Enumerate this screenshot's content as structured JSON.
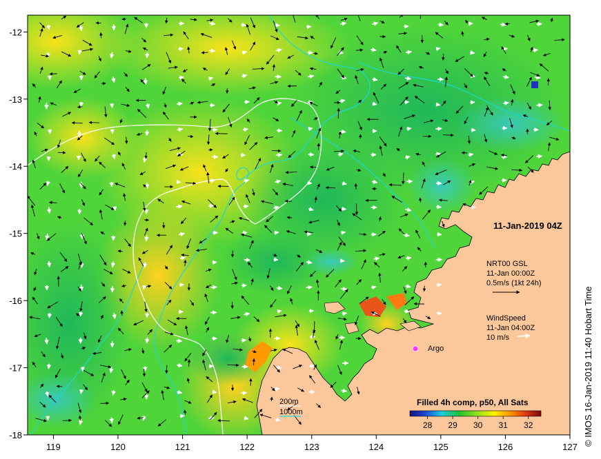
{
  "map": {
    "timestamp": "11-Jan-2019 04Z",
    "credit": "© IMOS 16-Jan-2019 11:40 Hobart Time",
    "longitude_ticks": [
      "119",
      "120",
      "121",
      "122",
      "123",
      "124",
      "125",
      "126",
      "127"
    ],
    "latitude_ticks": [
      "-12",
      "-13",
      "-14",
      "-15",
      "-16",
      "-17",
      "-18"
    ],
    "legend_currents": {
      "name": "NRT00 GSL",
      "time": "11-Jan 00:00Z",
      "scale": "0.5m/s (1kt 24h)"
    },
    "legend_wind": {
      "name": "WindSpeed",
      "time": "11-Jan 04:00Z",
      "scale": "10 m/s"
    },
    "argo_label": "Argo",
    "isobath_200": "200m",
    "isobath_1000": "1000m",
    "colorbar_title": "Filled 4h comp, p50, All Sats",
    "colorbar_ticks": [
      "28",
      "29",
      "30",
      "31",
      "32"
    ],
    "colors": {
      "land": "#fcc89b",
      "sst_low": "#1a1aa0",
      "sst_mid": "#27c82d",
      "sst_high": "#fff200",
      "isobath_200": "#ffffff",
      "isobath_1000": "#1ed6d6",
      "argo": "#ff33ff"
    }
  }
}
